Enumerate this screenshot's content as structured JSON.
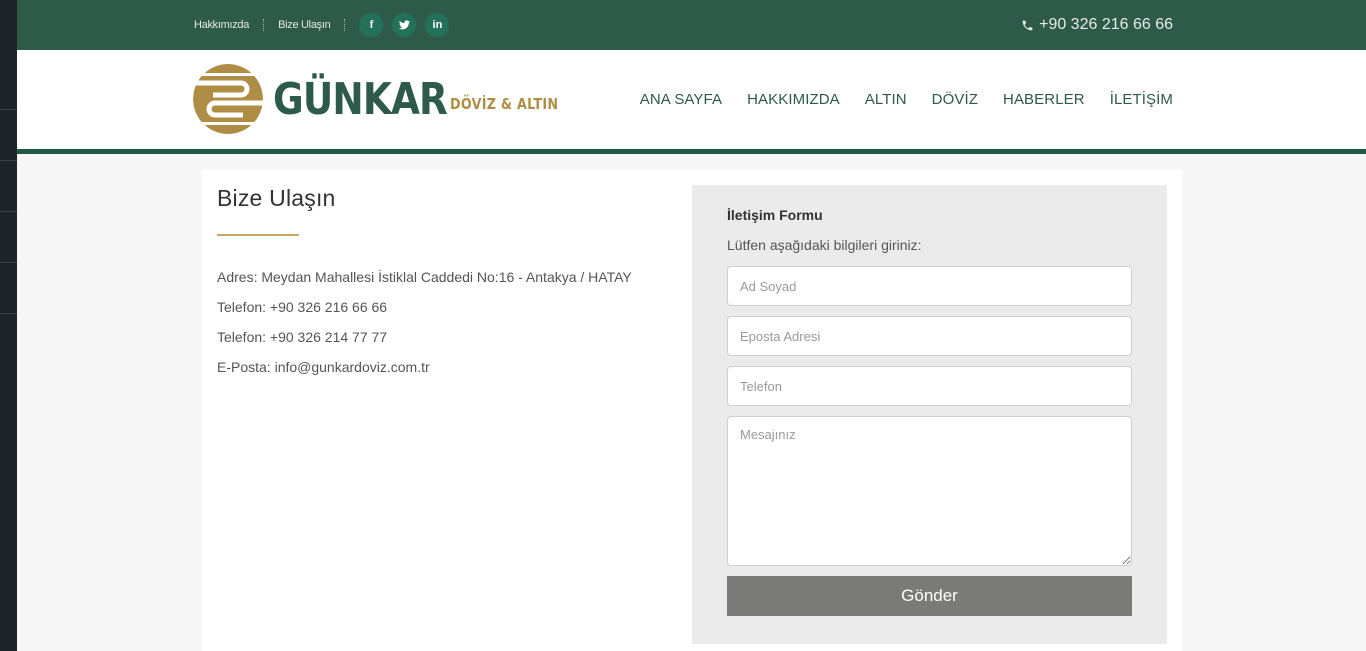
{
  "topbar": {
    "links": [
      "Hakkımızda",
      "Bize Ulaşın"
    ],
    "social": [
      "f",
      "t",
      "in"
    ],
    "phone": "+90 326 216 66 66"
  },
  "logo": {
    "brand": "GÜNKAR",
    "tagline": "DÖVİZ & ALTIN"
  },
  "nav": [
    "ANA SAYFA",
    "HAKKIMIZDA",
    "ALTIN",
    "DÖVİZ",
    "HABERLER",
    "İLETİŞİM"
  ],
  "contact": {
    "title": "Bize Ulaşın",
    "lines": [
      "Adres: Meydan Mahallesi İstiklal Caddedi No:16 - Antakya / HATAY",
      "Telefon: +90 326 216 66 66",
      "Telefon: +90 326 214 77 77",
      "E-Posta: info@gunkardoviz.com.tr"
    ]
  },
  "form": {
    "title": "İletişim Formu",
    "hint": "Lütfen aşağıdaki bilgileri giriniz:",
    "name_placeholder": "Ad Soyad",
    "email_placeholder": "Eposta Adresi",
    "phone_placeholder": "Telefon",
    "message_placeholder": "Mesajınız",
    "submit_label": "Gönder"
  },
  "colors": {
    "brand_green": "#2e5a4a",
    "brand_gold": "#b08d45",
    "accent_line": "#c5a766",
    "button": "#7a7a78"
  }
}
